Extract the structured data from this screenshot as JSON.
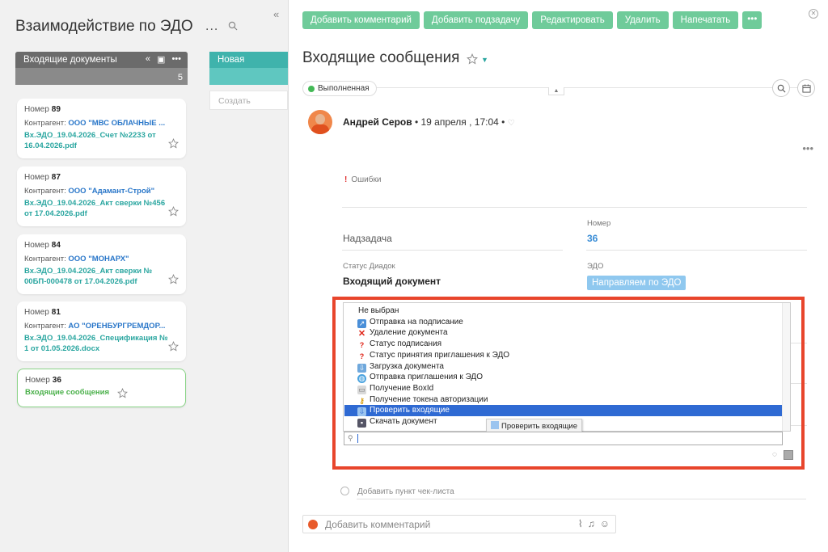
{
  "board": {
    "title": "Взаимодействие по ЭДО",
    "menu_dots": "...",
    "collapse": "«",
    "column1": {
      "title": "Входящие документы",
      "count": "5"
    },
    "column2": {
      "title": "Новая",
      "create_label": "Создать"
    }
  },
  "cards": [
    {
      "label": "Номер",
      "number": "89",
      "contr_label": "Контрагент:",
      "contr": "ООО \"МВС ОБЛАЧНЫЕ ...",
      "file": "Вх.ЭДО_19.04.2026_Счет №2233 от 16.04.2026.pdf"
    },
    {
      "label": "Номер",
      "number": "87",
      "contr_label": "Контрагент:",
      "contr": "ООО \"Адамант-Строй\"",
      "file": "Вх.ЭДО_19.04.2026_Акт сверки №456 от 17.04.2026.pdf"
    },
    {
      "label": "Номер",
      "number": "84",
      "contr_label": "Контрагент:",
      "contr": "ООО \"МОНАРХ\"",
      "file": "Вх.ЭДО_19.04.2026_Акт сверки № 00БП-000478 от 17.04.2026.pdf"
    },
    {
      "label": "Номер",
      "number": "81",
      "contr_label": "Контрагент:",
      "contr": "АО \"ОРЕНБУРГРЕМДОР...",
      "file": "Вх.ЭДО_19.04.2026_Спецификация № 1 от 01.05.2026.docx"
    },
    {
      "label": "Номер",
      "number": "36",
      "file": "Входящие сообщения"
    }
  ],
  "toolbar": {
    "add_comment": "Добавить комментарий",
    "add_subtask": "Добавить подзадачу",
    "edit": "Редактировать",
    "delete": "Удалить",
    "print": "Напечатать",
    "more": "•••"
  },
  "task": {
    "title": "Входящие сообщения",
    "status": "Выполненная",
    "author": "Андрей Серов",
    "date": "• 19 апреля , 17:04 •",
    "errors_label": "Ошибки",
    "parent_label": "Надзадача",
    "number_label": "Номер",
    "number_value": "36",
    "diadoc_label": "Статус Диадок",
    "diadoc_value": "Входящий документ",
    "edo_label": "ЭДО",
    "edo_value": "Направляем по ЭДО"
  },
  "dropdown": {
    "items": [
      {
        "label": "Не выбран",
        "icon": "none"
      },
      {
        "label": "Отправка на подписание",
        "icon": "send-icon"
      },
      {
        "label": "Удаление документа",
        "icon": "delete-x-icon"
      },
      {
        "label": "Статус подписания",
        "icon": "question-icon"
      },
      {
        "label": "Статус принятия приглашения к ЭДО",
        "icon": "question-icon"
      },
      {
        "label": "Загрузка документа",
        "icon": "upload-icon"
      },
      {
        "label": "Отправка приглашения к ЭДО",
        "icon": "globe-icon"
      },
      {
        "label": "Получение BoxId",
        "icon": "box-icon"
      },
      {
        "label": "Получение токена авторизации",
        "icon": "key-icon"
      },
      {
        "label": "Проверить входящие",
        "icon": "inbox-icon"
      },
      {
        "label": "Скачать документ",
        "icon": "save-icon"
      }
    ],
    "selected_index": 9,
    "tooltip": "Проверить входящие"
  },
  "checklist": {
    "add_label": "Добавить пункт чек-листа"
  },
  "comment": {
    "placeholder": "Добавить комментарий"
  },
  "colors": {
    "accent_green": "#6fcb9a",
    "teal": "#2aa6a0",
    "highlight_red": "#e8452c",
    "selection_blue": "#2f6ad3"
  }
}
